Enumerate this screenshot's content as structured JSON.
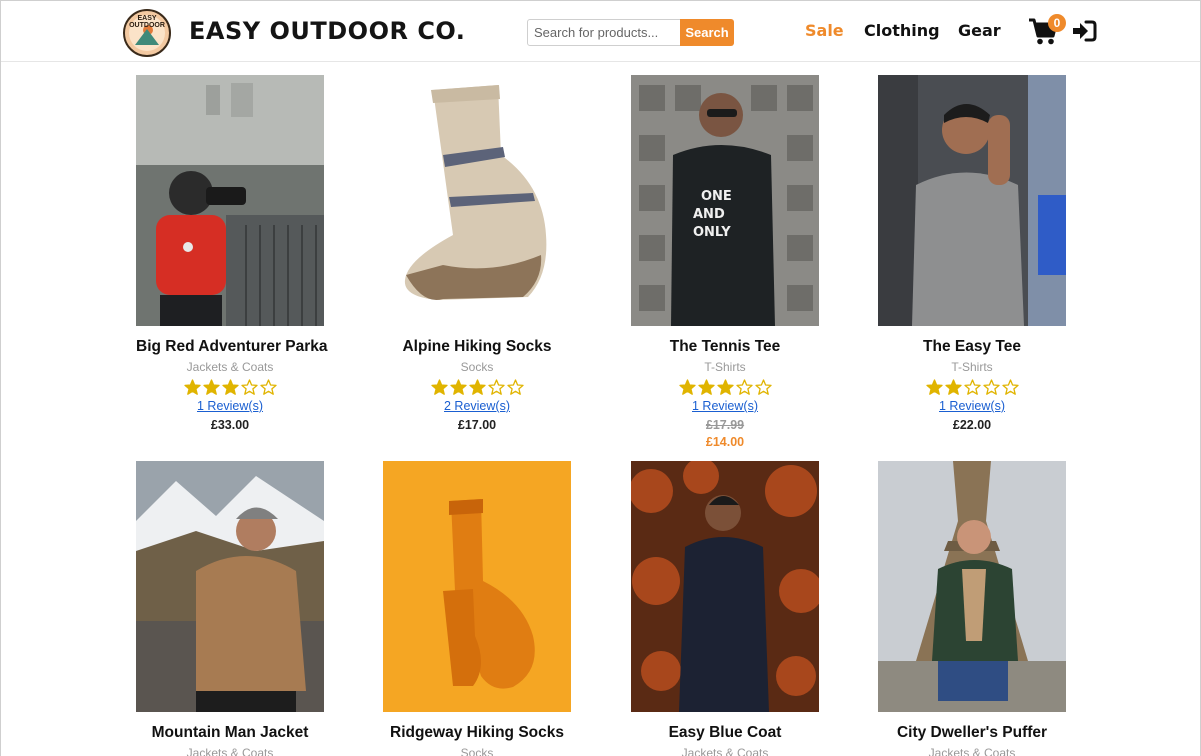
{
  "header": {
    "logo_text": "EASY OUTDOOR",
    "brand": "EASY OUTDOOR CO.",
    "search_placeholder": "Search for products...",
    "search_label": "Search",
    "nav": {
      "sale": "Sale",
      "clothing": "Clothing",
      "gear": "Gear"
    },
    "cart_count": "0"
  },
  "colors": {
    "accent": "#ef8a2b",
    "star": "#e0b400",
    "link": "#1a5fd1"
  },
  "products": [
    {
      "title": "Big Red Adventurer Parka",
      "category": "Jackets & Coats",
      "rating": 3,
      "reviews": "1 Review(s)",
      "price": "£33.00",
      "image": "man-red-parka-camera-photo"
    },
    {
      "title": "Alpine Hiking Socks",
      "category": "Socks",
      "rating": 3,
      "reviews": "2 Review(s)",
      "price": "£17.00",
      "image": "beige-hiking-sock-photo"
    },
    {
      "title": "The Tennis Tee",
      "category": "T-Shirts",
      "rating": 3,
      "reviews": "1 Review(s)",
      "old_price": "£17.99",
      "sale_price": "£14.00",
      "image": "man-black-tee-photo"
    },
    {
      "title": "The Easy Tee",
      "category": "T-Shirts",
      "rating": 2,
      "reviews": "1 Review(s)",
      "price": "£22.00",
      "image": "man-grey-tee-photo"
    },
    {
      "title": "Mountain Man Jacket",
      "category": "Jackets & Coats",
      "image": "man-tan-jacket-mountains-photo"
    },
    {
      "title": "Ridgeway Hiking Socks",
      "category": "Socks",
      "image": "orange-socks-photo"
    },
    {
      "title": "Easy Blue Coat",
      "category": "Jackets & Coats",
      "image": "man-navy-coat-autumn-photo"
    },
    {
      "title": "City Dweller's Puffer",
      "category": "Jackets & Coats",
      "image": "man-green-puffer-eiffel-photo"
    }
  ]
}
